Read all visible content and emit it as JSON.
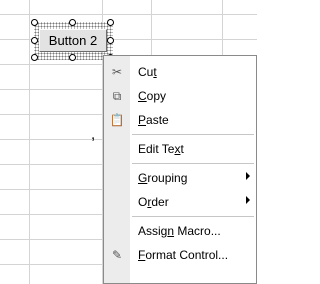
{
  "button": {
    "label": "Button 2"
  },
  "cell_text": ",",
  "context_menu": {
    "items": [
      {
        "pre": "Cu",
        "acc": "t",
        "post": "",
        "icon": "scissors-icon",
        "glyph": "✂",
        "submenu": false
      },
      {
        "pre": "",
        "acc": "C",
        "post": "opy",
        "icon": "copy-icon",
        "glyph": "⧉",
        "submenu": false
      },
      {
        "pre": "",
        "acc": "P",
        "post": "aste",
        "icon": "paste-icon",
        "glyph": "📋",
        "submenu": false
      },
      {
        "separator": true
      },
      {
        "pre": "Edit Te",
        "acc": "x",
        "post": "t",
        "icon": "",
        "glyph": "",
        "submenu": false
      },
      {
        "separator": true
      },
      {
        "pre": "",
        "acc": "G",
        "post": "rouping",
        "icon": "",
        "glyph": "",
        "submenu": true
      },
      {
        "pre": "O",
        "acc": "r",
        "post": "der",
        "icon": "",
        "glyph": "",
        "submenu": true
      },
      {
        "separator": true
      },
      {
        "pre": "Assig",
        "acc": "n",
        "post": " Macro...",
        "icon": "",
        "glyph": "",
        "submenu": false
      },
      {
        "pre": "",
        "acc": "F",
        "post": "ormat Control...",
        "icon": "format-control-icon",
        "glyph": "✎",
        "submenu": false
      }
    ]
  }
}
